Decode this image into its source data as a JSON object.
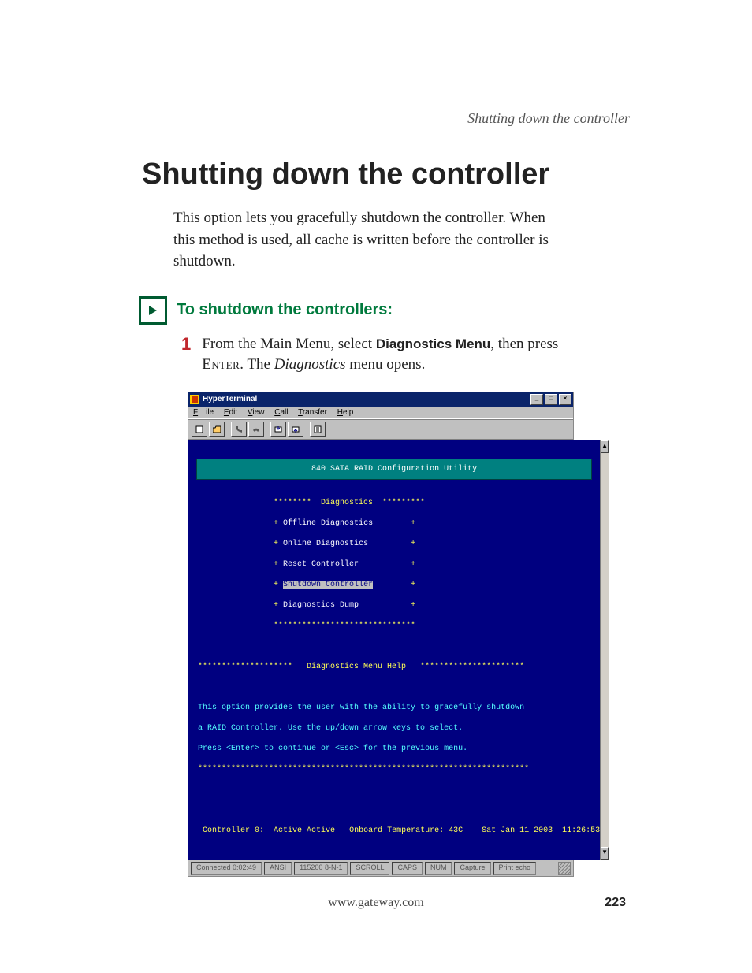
{
  "runningHeader": "Shutting down the controller",
  "title": "Shutting down the controller",
  "intro": "This option lets you gracefully shutdown the controller. When this method is used, all cache is written before the controller is shutdown.",
  "taskTitle": "To shutdown the controllers:",
  "step1": {
    "number": "1",
    "prefix": "From the Main Menu, select ",
    "boldA": "Diagnostics Menu",
    "mid": ", then press ",
    "boldB": "Enter",
    "mid2": ". The ",
    "italic": "Diagnostics",
    "suffix": " menu opens."
  },
  "ht": {
    "title": "HyperTerminal",
    "menus": [
      "File",
      "Edit",
      "View",
      "Call",
      "Transfer",
      "Help"
    ],
    "termBanner": "840 SATA RAID Configuration Utility",
    "diagHeader": "********  Diagnostics  *********",
    "menuLines": [
      "Offline Diagnostics",
      "Online Diagnostics",
      "Reset Controller",
      "Shutdown Controller",
      "Diagnostics Dump"
    ],
    "menuStars": "******************************",
    "helpHeader": "********************   Diagnostics Menu Help   **********************",
    "helpBody1": "This option provides the user with the ability to gracefully shutdown",
    "helpBody2": "a RAID Controller. Use the up/down arrow keys to select.",
    "helpBody3": "Press <Enter> to continue or <Esc> for the previous menu.",
    "helpStars": "**********************************************************************",
    "statusLine": {
      "controller": "Controller 0:  Active Active",
      "temp": "Onboard Temperature: 43C",
      "date": "Sat Jan 11 2003  11:26:53"
    },
    "bottomStatus": [
      "Connected 0:02:49",
      "ANSI",
      "115200 8-N-1",
      "SCROLL",
      "CAPS",
      "NUM",
      "Capture",
      "Print echo"
    ]
  },
  "footer": {
    "url": "www.gateway.com",
    "page": "223"
  }
}
